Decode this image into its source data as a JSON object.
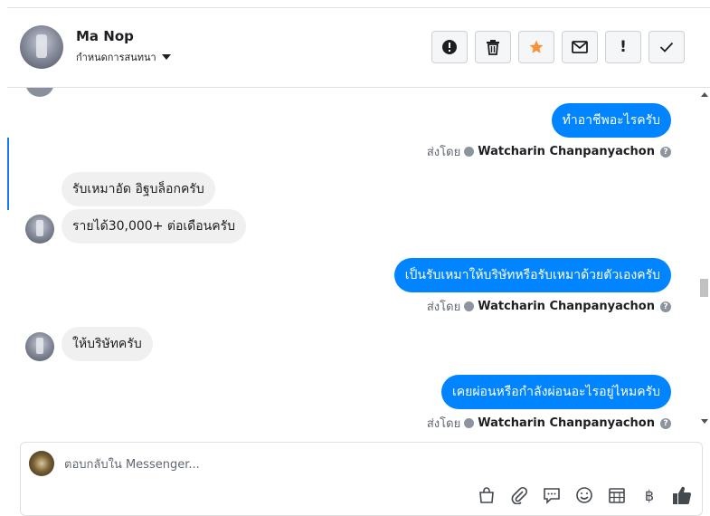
{
  "contact": {
    "name": "Ma Nop",
    "subtitle": "กำหนดการสนทนา"
  },
  "toolbar": {
    "buttons": [
      {
        "icon": "alert-circle-icon"
      },
      {
        "icon": "trash-icon"
      },
      {
        "icon": "star-icon",
        "color": "#f7923a"
      },
      {
        "icon": "envelope-icon"
      },
      {
        "icon": "exclamation-icon",
        "label": "!"
      },
      {
        "icon": "checkmark-icon"
      }
    ]
  },
  "messages": [
    {
      "direction": "out",
      "text": "ทำอาชีพอะไรครับ"
    },
    {
      "direction": "in",
      "text": "รับเหมาอัด อิฐบล็อกครับ"
    },
    {
      "direction": "in",
      "text": "รายได้30,000+ ต่อเดือนครับ"
    },
    {
      "direction": "out",
      "text": "เป็นรับเหมาให้บริษัทหรือรับเหมาด้วยตัวเองครับ"
    },
    {
      "direction": "in",
      "text": "ให้บริษัทครับ"
    },
    {
      "direction": "out",
      "text": "เคยผ่อนหรือกำลังผ่อนอะไรอยู่ไหมครับ"
    }
  ],
  "sent_by": {
    "prefix": "ส่งโดย",
    "sender": "Watcharin Chanpanyachon"
  },
  "composer": {
    "placeholder": "ตอบกลับใน Messenger...",
    "tools": [
      "shopping-bag-icon",
      "paperclip-icon",
      "chat-bubble-icon",
      "emoji-icon",
      "calendar-icon",
      "baht-icon",
      "thumbs-up-icon"
    ],
    "baht_symbol": "฿"
  },
  "colors": {
    "outgoing_bubble": "#0084ff",
    "incoming_bubble": "#f0f0f0",
    "accent": "#1877f2"
  }
}
